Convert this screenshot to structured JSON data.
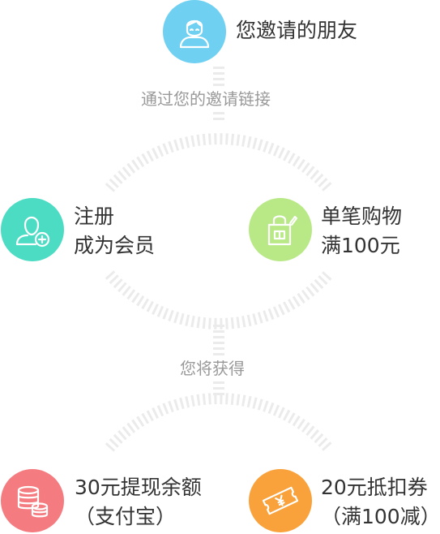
{
  "friend": {
    "label": "您邀请的朋友",
    "icon": "user-avatar-icon",
    "color": "#6FD0F2"
  },
  "via_text": "通过您的邀请链接",
  "steps": [
    {
      "line1": "注册",
      "line2": "成为会员",
      "icon": "add-user-icon",
      "color": "#4CDCC4"
    },
    {
      "line1": "单笔购物",
      "line2": "满100元",
      "icon": "shopping-bag-icon",
      "color": "#B8E986"
    }
  ],
  "get_text": "您将获得",
  "rewards": [
    {
      "line1": "30元提现余额",
      "line2": "（支付宝）",
      "icon": "coins-icon",
      "color": "#F47C80"
    },
    {
      "line1": "20元抵扣券",
      "line2": "（满100减）",
      "icon": "coupon-icon",
      "color": "#F9A23B"
    }
  ]
}
